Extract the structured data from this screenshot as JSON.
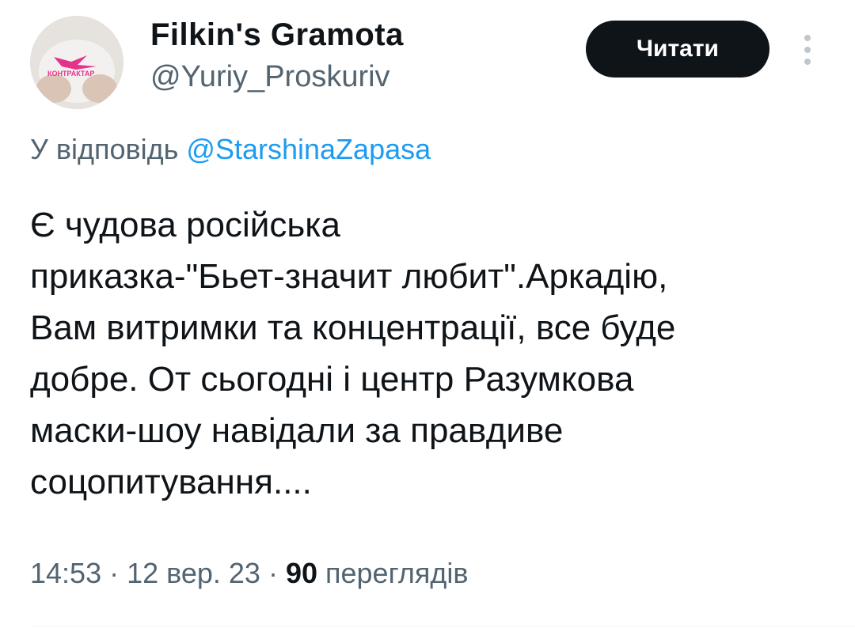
{
  "author": {
    "display_name": "Filkin's Gramota",
    "handle": "@Yuriy_Proskuriv",
    "avatar_text": "КОНТРАКТАР"
  },
  "header": {
    "follow_label": "Читати",
    "more_icon": "vertical-ellipsis-icon"
  },
  "reply": {
    "prefix": "У відповідь",
    "mention": "@StarshinaZapasa"
  },
  "tweet": {
    "lines": [
      "Є чудова російська",
      "приказка-\"Бьет-значит любит\".Аркадію,",
      "Вам витримки та концентрації, все буде",
      "добре. От сьогодні і центр Разумкова",
      "маски-шоу навідали за правдиве",
      "соцопитування...."
    ]
  },
  "meta": {
    "time": "14:53",
    "sep1": " · ",
    "date": "12 вер. 23",
    "sep2": " · ",
    "views_count": "90",
    "views_label": "переглядів"
  },
  "colors": {
    "text": "#0f1419",
    "secondary": "#536471",
    "link": "#1d9bf0",
    "button_bg": "#0f1419",
    "button_text": "#ffffff"
  }
}
